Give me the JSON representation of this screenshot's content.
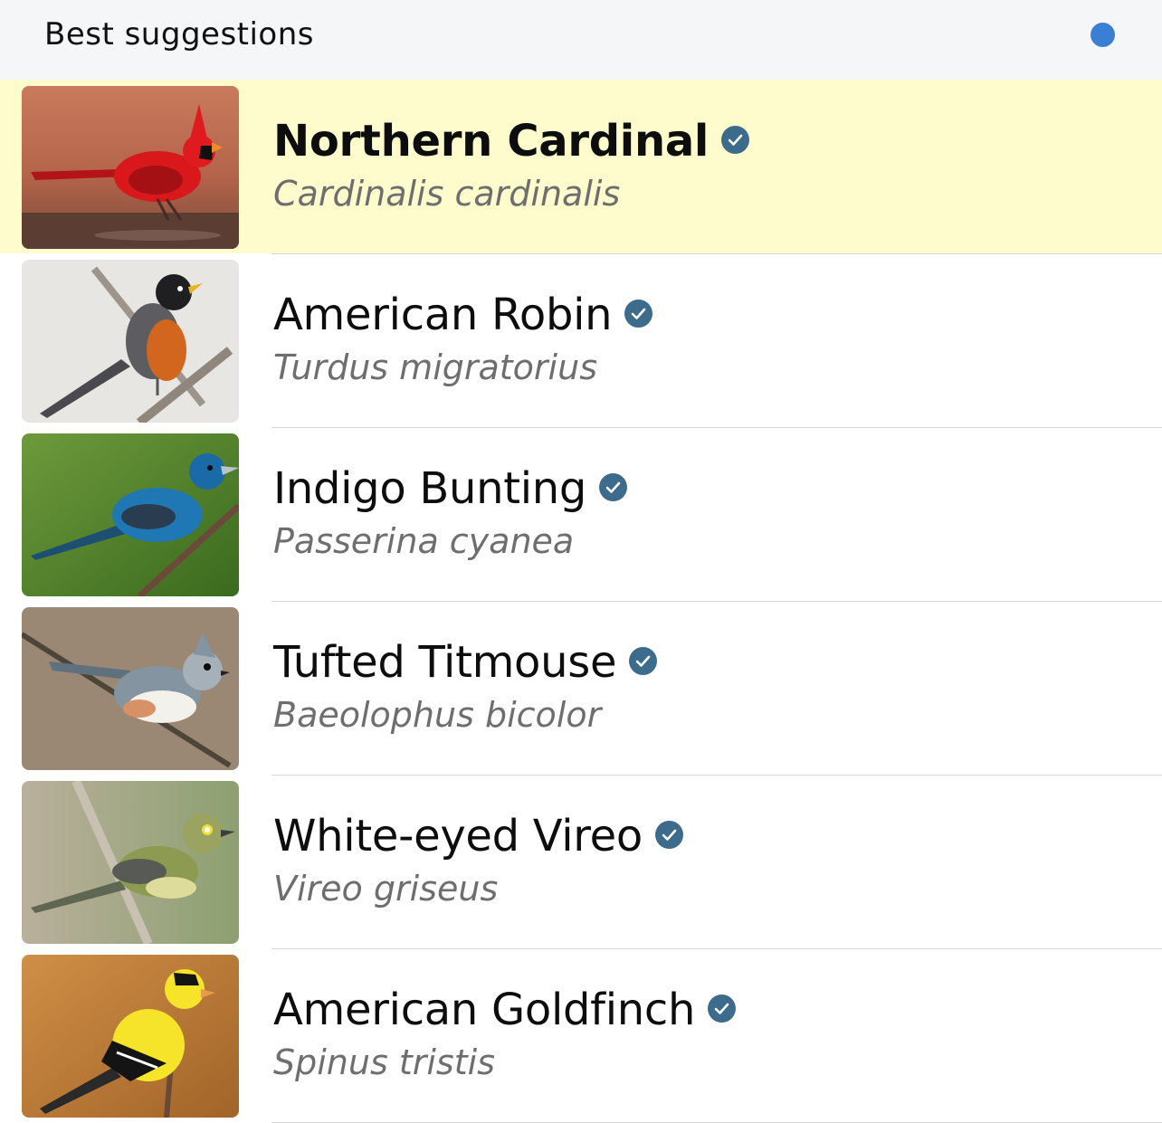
{
  "header": {
    "title": "Best suggestions",
    "status_dot_color": "#3b7fd4"
  },
  "suggestions": [
    {
      "common_name": "Northern Cardinal",
      "scientific_name": "Cardinalis cardinalis",
      "verified": true,
      "selected": true,
      "photo": "northern-cardinal-photo"
    },
    {
      "common_name": "American Robin",
      "scientific_name": "Turdus migratorius",
      "verified": true,
      "selected": false,
      "photo": "american-robin-photo"
    },
    {
      "common_name": "Indigo Bunting",
      "scientific_name": "Passerina cyanea",
      "verified": true,
      "selected": false,
      "photo": "indigo-bunting-photo"
    },
    {
      "common_name": "Tufted Titmouse",
      "scientific_name": "Baeolophus bicolor",
      "verified": true,
      "selected": false,
      "photo": "tufted-titmouse-photo"
    },
    {
      "common_name": "White-eyed Vireo",
      "scientific_name": "Vireo griseus",
      "verified": true,
      "selected": false,
      "photo": "white-eyed-vireo-photo"
    },
    {
      "common_name": "American Goldfinch",
      "scientific_name": "Spinus tristis",
      "verified": true,
      "selected": false,
      "photo": "american-goldfinch-photo"
    }
  ],
  "colors": {
    "selected_row_background": "#fefbcd",
    "verified_badge": "#3d6b8c"
  }
}
